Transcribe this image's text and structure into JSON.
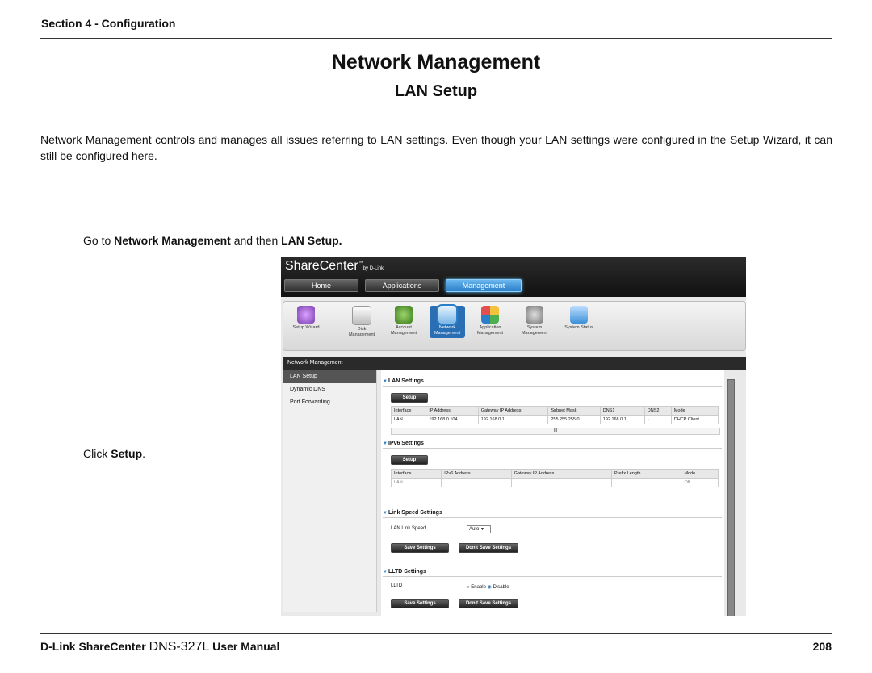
{
  "header": {
    "section": "Section 4 - Configuration"
  },
  "title": "Network Management",
  "subtitle": "LAN Setup",
  "intro": "Network Management controls and manages all issues referring to LAN settings. Even though your LAN settings were configured in the Setup Wizard, it can still be configured here.",
  "step1": {
    "prefix": "Go to ",
    "bold1": "Network Management",
    "middle": " and then ",
    "bold2": "LAN Setup."
  },
  "step2": {
    "prefix": "Click ",
    "bold": "Setup",
    "suffix": "."
  },
  "footer": {
    "brand": "D-Link ShareCenter ",
    "model": "DNS-327L",
    "suffix": " User Manual",
    "page": "208"
  },
  "app": {
    "brand": "ShareCenter",
    "brand_tm": "™",
    "brand_by": "by D-Link",
    "nav": [
      "Home",
      "Applications",
      "Management"
    ],
    "icons": [
      {
        "label": "Setup Wizard",
        "icon": "wizard-icon"
      },
      {
        "label": "Disk Management",
        "icon": "disk-icon"
      },
      {
        "label": "Account Management",
        "icon": "account-icon"
      },
      {
        "label": "Network Management",
        "icon": "network-icon"
      },
      {
        "label": "Application Management",
        "icon": "application-icon"
      },
      {
        "label": "System Management",
        "icon": "system-icon"
      },
      {
        "label": "System Status",
        "icon": "status-icon"
      }
    ],
    "panel_title": "Network Management",
    "sidebar": [
      "LAN Setup",
      "Dynamic DNS",
      "Port Forwarding"
    ],
    "lan": {
      "title": "LAN Settings",
      "button": "Setup",
      "headers": [
        "Interface",
        "IP Address",
        "Gateway IP Address",
        "Subnet Mask",
        "DNS1",
        "DNS2",
        "Mode"
      ],
      "row": [
        "LAN",
        "192.168.0.104",
        "192.168.0.1",
        "255.255.255.0",
        "192.168.0.1",
        "-",
        "DHCP Client"
      ],
      "scroll_mark": "III"
    },
    "ipv6": {
      "title": "IPv6 Settings",
      "button": "Setup",
      "headers": [
        "Interface",
        "IPv6 Address",
        "Gateway IP Address",
        "Prefix Length",
        "Mode"
      ],
      "row": [
        "LAN",
        "",
        "",
        "",
        "Off"
      ]
    },
    "link": {
      "title": "Link Speed Settings",
      "label": "LAN Link Speed",
      "value": "Auto",
      "save": "Save Settings",
      "dont": "Don't Save Settings"
    },
    "lltd": {
      "title": "LLTD Settings",
      "label": "LLTD",
      "enable": "Enable",
      "disable": "Disable",
      "save": "Save Settings",
      "dont": "Don't Save Settings"
    }
  }
}
